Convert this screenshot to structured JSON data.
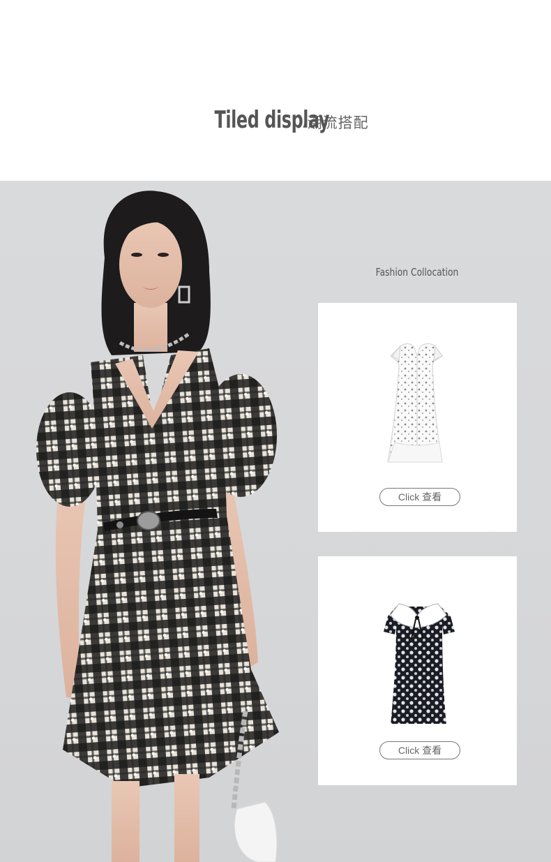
{
  "header": {
    "title_en": "Tiled  display",
    "separator": "/",
    "title_cn": "潮流搭配"
  },
  "collocation": {
    "label": "Fashion Collocation",
    "items": [
      {
        "button_label": "Click 查看",
        "product": "white-floral-dress"
      },
      {
        "button_label": "Click 查看",
        "product": "black-floral-dress"
      }
    ]
  },
  "colors": {
    "panel_bg": "#d7d8da",
    "title": "#555555",
    "card_bg": "#ffffff"
  }
}
